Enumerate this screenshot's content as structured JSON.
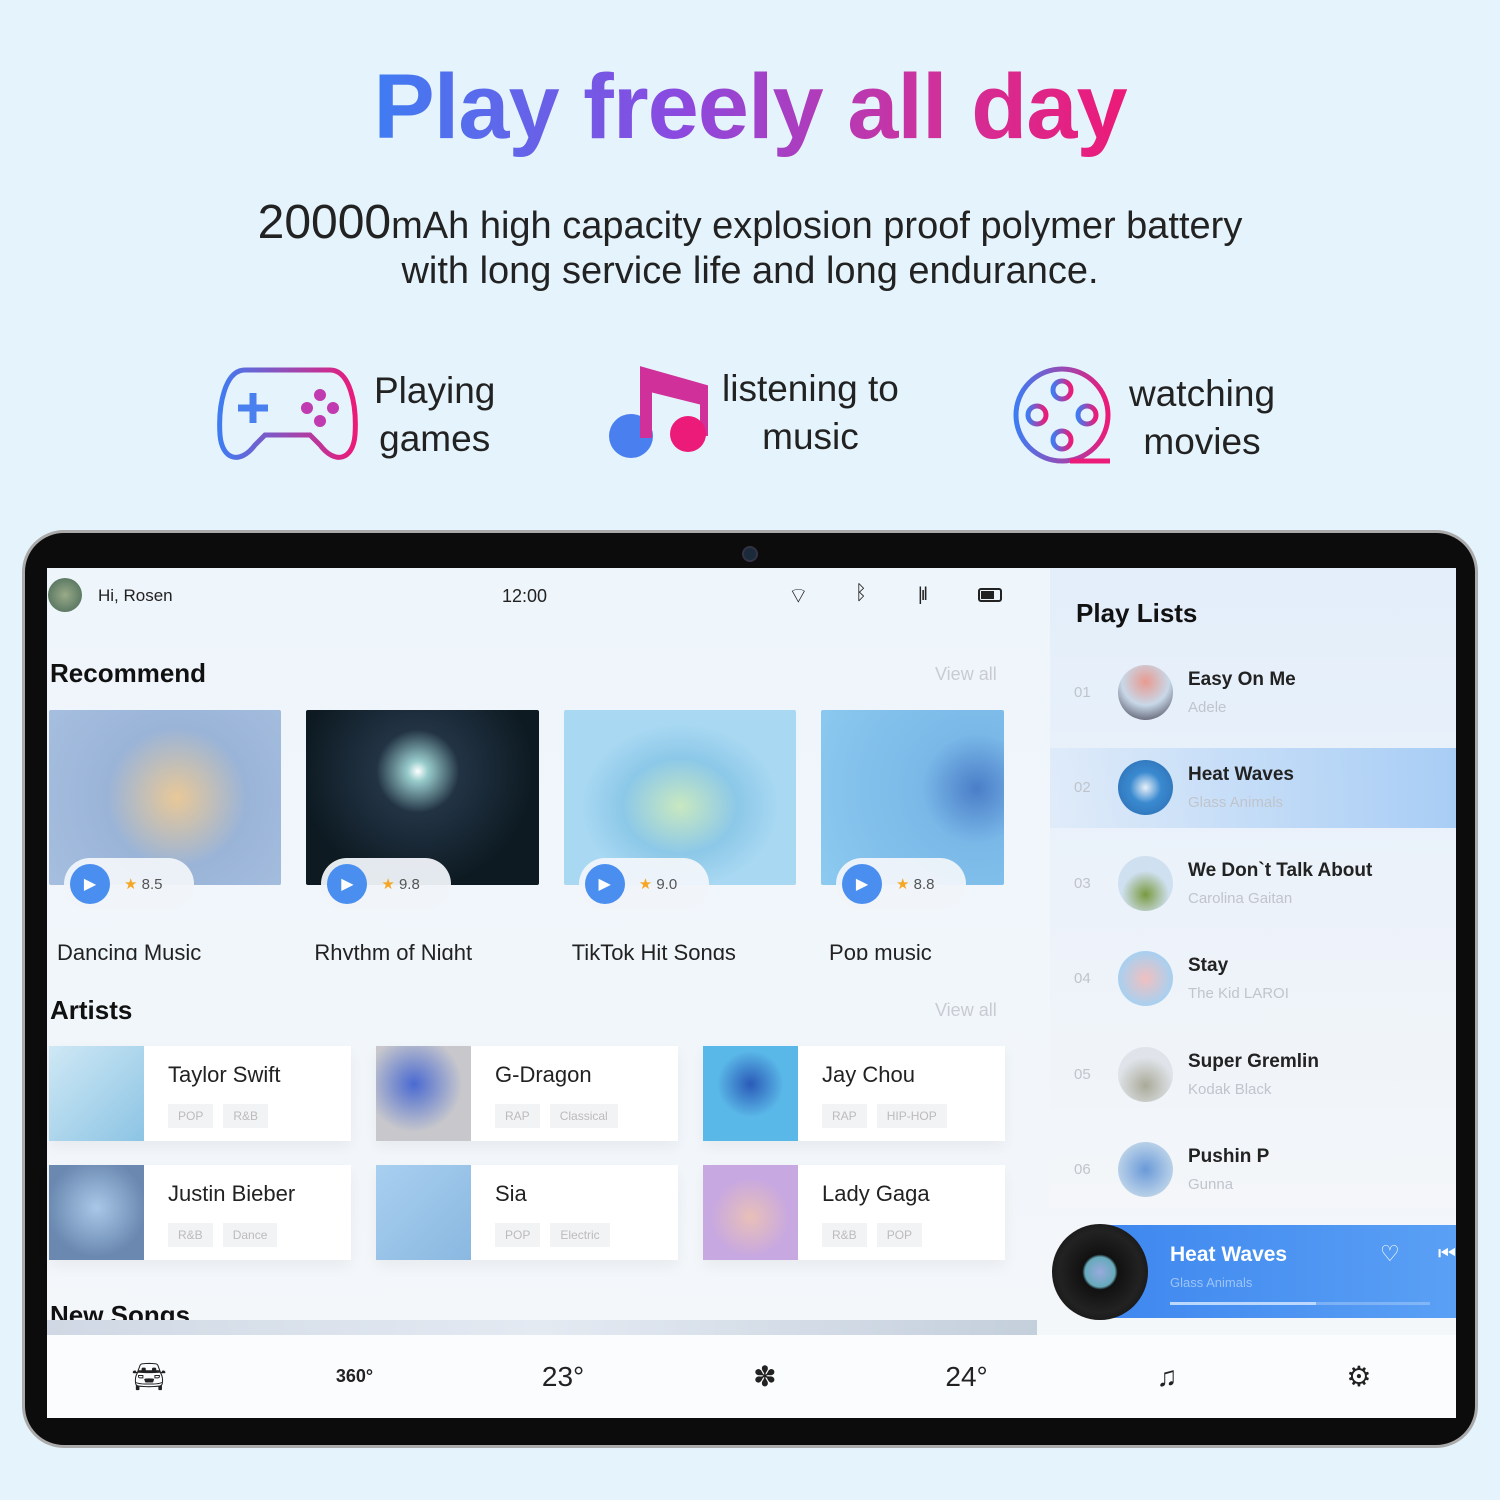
{
  "headline": "Play freely all day",
  "subtitle": {
    "capacity": "20000",
    "line1": "mAh high capacity explosion proof polymer battery",
    "line2": "with long service life and long endurance."
  },
  "features": [
    {
      "icon": "gamepad-icon",
      "l1": "Playing",
      "l2": "games"
    },
    {
      "icon": "music-note-icon",
      "l1": "listening to",
      "l2": "music"
    },
    {
      "icon": "film-reel-icon",
      "l1": "watching",
      "l2": "movies"
    }
  ],
  "status": {
    "greeting": "Hi, Rosen",
    "time": "12:00"
  },
  "recommend": {
    "title": "Recommend",
    "view_all": "View all",
    "items": [
      {
        "name": "Dancing Music",
        "rating": "8.5"
      },
      {
        "name": "Rhythm of Night",
        "rating": "9.8"
      },
      {
        "name": "TikTok Hit Songs",
        "rating": "9.0"
      },
      {
        "name": "Pop music",
        "rating": "8.8"
      }
    ]
  },
  "artists": {
    "title": "Artists",
    "view_all": "View all",
    "items": [
      {
        "name": "Taylor Swift",
        "tags": [
          "POP",
          "R&B"
        ]
      },
      {
        "name": "G-Dragon",
        "tags": [
          "RAP",
          "Classical"
        ]
      },
      {
        "name": "Jay Chou",
        "tags": [
          "RAP",
          "HIP-HOP"
        ]
      },
      {
        "name": "Justin Bieber",
        "tags": [
          "R&B",
          "Dance"
        ]
      },
      {
        "name": "Sia",
        "tags": [
          "POP",
          "Electric"
        ]
      },
      {
        "name": "Lady Gaga",
        "tags": [
          "R&B",
          "POP"
        ]
      }
    ]
  },
  "new_songs": {
    "title": "New Songs"
  },
  "playlists": {
    "title": "Play Lists",
    "items": [
      {
        "num": "01",
        "title": "Easy On Me",
        "artist": "Adele"
      },
      {
        "num": "02",
        "title": "Heat Waves",
        "artist": "Glass Animals"
      },
      {
        "num": "03",
        "title": "We Don`t Talk About",
        "artist": "Carolina Gaitan"
      },
      {
        "num": "04",
        "title": "Stay",
        "artist": "The Kid LAROI"
      },
      {
        "num": "05",
        "title": "Super Gremlin",
        "artist": "Kodak Black"
      },
      {
        "num": "06",
        "title": "Pushin P",
        "artist": "Gunna"
      }
    ],
    "active_index": 1
  },
  "now_playing": {
    "title": "Heat Waves",
    "artist": "Glass Animals",
    "progress": 0.56
  },
  "bottom_bar": {
    "temp_left": "23°",
    "temp_right": "24°",
    "view360": "360°"
  },
  "colors": {
    "accent": "#4a8ff0",
    "title_gradient": [
      "#3f7cf2",
      "#8a4ae0",
      "#ec1a78"
    ]
  }
}
